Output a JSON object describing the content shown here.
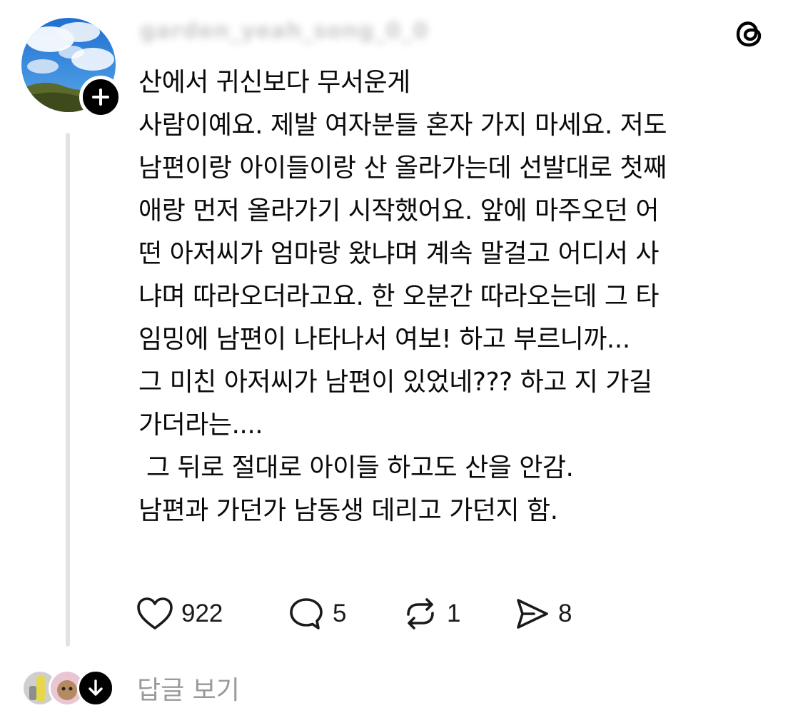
{
  "post": {
    "author_hidden": "garden_yeah_song_0_0",
    "lines": [
      "산에서 귀신보다 무서운게",
      "사람이예요. 제발 여자분들 혼자 가지 마세요. 저도",
      "남편이랑 아이들이랑 산 올라가는데 선발대로 첫째",
      "애랑 먼저 올라가기 시작했어요. 앞에 마주오던 어",
      "떤 아저씨가 엄마랑 왔냐며 계속 말걸고 어디서 사",
      "냐며 따라오더라고요. 한 오분간 따라오는데 그 타",
      "임밍에 남편이 나타나서 여보! 하고 부르니까...",
      "그 미친 아저씨가 남편이 있었네??? 하고 지 가길",
      "가더라는....",
      " 그 뒤로 절대로 아이들 하고도 산을 안감.",
      "남편과 가던가 남동생 데리고 가던지 함."
    ]
  },
  "actions": {
    "likes": "922",
    "replies": "5",
    "reposts": "1",
    "shares": "8"
  },
  "footer": {
    "view_replies_label": "답글 보기"
  },
  "icons": {
    "app_logo": "threads-icon",
    "follow": "plus-icon",
    "like": "heart-icon",
    "reply": "speech-bubble-icon",
    "repost": "repost-icon",
    "share": "send-icon",
    "expand": "arrow-down-icon"
  },
  "colors": {
    "text": "#0a0a0a",
    "muted": "#9a9a9a",
    "thread_line": "#e2e2e2",
    "icon": "#1a1a1a"
  }
}
